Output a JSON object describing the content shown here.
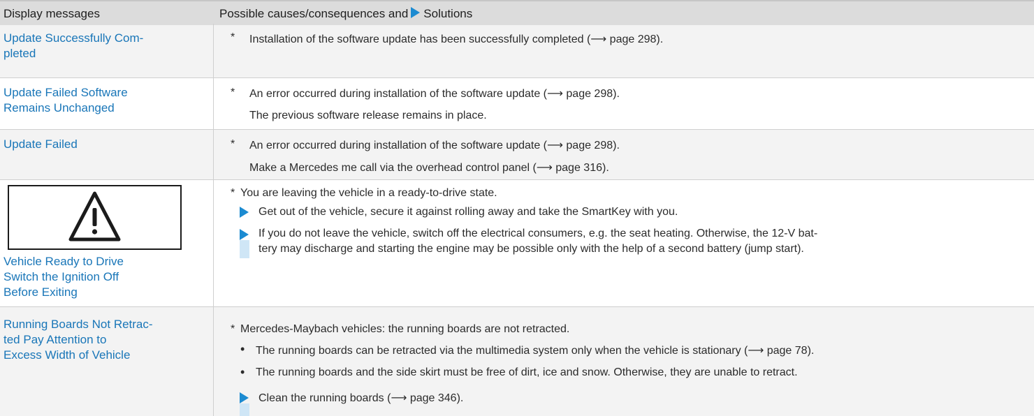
{
  "header": {
    "col1": "Display messages",
    "col2_prefix": "Possible causes/consequences and",
    "col2_suffix": "Solutions"
  },
  "rows": [
    {
      "message_lines": [
        "Update Successfully Com-",
        "pleted"
      ],
      "star": "*",
      "lines": [
        "Installation of the software update has been successfully completed (⟶ page 298)."
      ]
    },
    {
      "message_lines": [
        "Update Failed Software",
        "Remains Unchanged"
      ],
      "star": "*",
      "lines": [
        "An error occurred during installation of the software update (⟶ page 298).",
        "The previous software release remains in place."
      ]
    },
    {
      "message_lines": [
        "Update Failed"
      ],
      "star": "*",
      "lines": [
        "An error occurred during installation of the software update (⟶ page 298).",
        "Make a Mercedes me call via the overhead control panel (⟶ page 316)."
      ]
    },
    {
      "warning_icon": "warning-triangle-icon",
      "message_lines": [
        "Vehicle Ready to Drive",
        "Switch the Ignition Off",
        "Before Exiting"
      ],
      "star": "*",
      "lines": [
        "You are leaving the vehicle in a ready-to-drive state."
      ],
      "steps": [
        {
          "lines": [
            "Get out of the vehicle, secure it against rolling away and take the SmartKey with you."
          ]
        },
        {
          "lines": [
            "If you do not leave the vehicle, switch off the electrical consumers, e.g. the seat heating. Otherwise, the 12-V bat-",
            "tery may discharge and starting the engine may be possible only with the help of a second battery (jump start)."
          ]
        }
      ]
    },
    {
      "message_lines": [
        "Running Boards Not Retrac-",
        "ted Pay Attention to",
        "Excess Width of Vehicle"
      ],
      "star": "*",
      "lines": [
        "Mercedes-Maybach vehicles: the running boards are not retracted."
      ],
      "bullets": [
        "The running boards can be retracted via the multimedia system only when the vehicle is stationary (⟶ page 78).",
        "The running boards and the side skirt must be free of dirt, ice and snow. Otherwise, they are unable to retract."
      ],
      "steps": [
        {
          "lines": [
            "Clean the running boards (⟶ page 346)."
          ]
        }
      ]
    }
  ],
  "colors": {
    "accent": "#1c8bd1",
    "message_text": "#1976b8",
    "header_bg": "#dcdcdc",
    "row_shade": "#f3f3f3"
  }
}
